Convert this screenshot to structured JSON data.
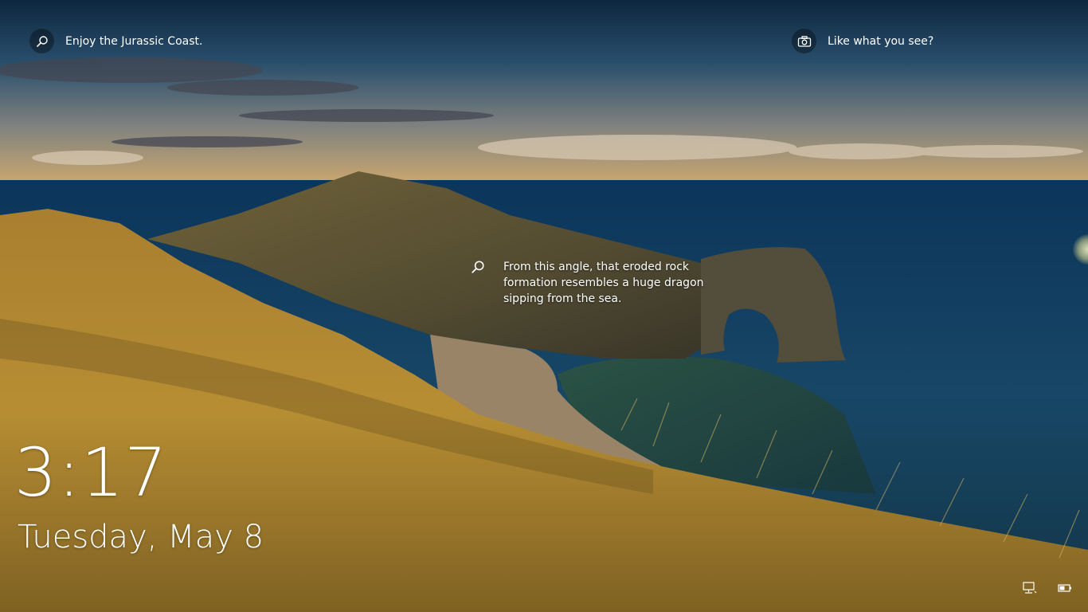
{
  "spotlight": {
    "title": "Enjoy the Jurassic Coast.",
    "feedback_prompt": "Like what you see?"
  },
  "hotspot": {
    "text": "From this angle, that eroded rock formation resembles a huge dragon sipping from the sea."
  },
  "clock": {
    "time": "3:17",
    "date": "Tuesday, May 8"
  },
  "tray": {
    "network_icon": "network-icon",
    "battery_icon": "battery-icon"
  },
  "colors": {
    "text": "#ffffff",
    "sky_top": "#0f2a44",
    "sea": "#1b4f73",
    "grass": "#c9a23a"
  }
}
